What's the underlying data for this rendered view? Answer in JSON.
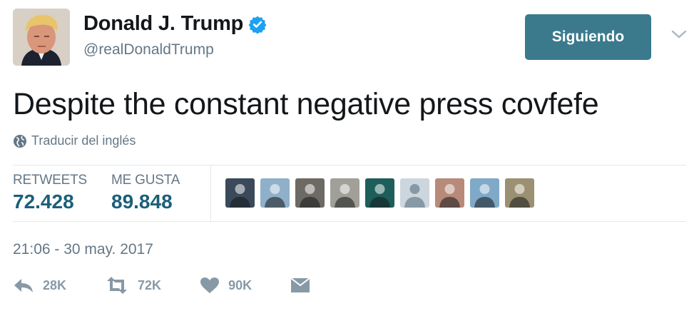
{
  "user": {
    "display_name": "Donald J. Trump",
    "handle": "@realDonaldTrump",
    "verified": true,
    "avatar_icon": "profile-photo"
  },
  "follow_button": {
    "label": "Siguiendo"
  },
  "tweet": {
    "text": "Despite the constant negative press covfefe",
    "translate_label": "Traducir del inglés"
  },
  "stats": {
    "retweets_label": "RETWEETS",
    "retweets_value": "72.428",
    "likes_label": "ME GUSTA",
    "likes_value": "89.848"
  },
  "likers": [
    {
      "icon": "group-selfie-avatar",
      "bg": "#3a4a5a"
    },
    {
      "icon": "cartoon-person-avatar",
      "bg": "#8fb0c8"
    },
    {
      "icon": "person-with-dog-avatar",
      "bg": "#6d6a63"
    },
    {
      "icon": "person-with-pet-avatar",
      "bg": "#a0a098"
    },
    {
      "icon": "white-cat-avatar",
      "bg": "#1e5e5a"
    },
    {
      "icon": "default-egg-avatar",
      "bg": "#ccd6dd"
    },
    {
      "icon": "person-sunset-avatar",
      "bg": "#b88a7a"
    },
    {
      "icon": "person-sky-avatar",
      "bg": "#7fa9c7"
    },
    {
      "icon": "person-outdoors-avatar",
      "bg": "#9b9071"
    }
  ],
  "timestamp": "21:06 - 30 may. 2017",
  "actions": {
    "reply_count": "28K",
    "retweet_count": "72K",
    "like_count": "90K"
  },
  "colors": {
    "follow_bg": "#3a7a8c",
    "stat_value": "#1b5f7a",
    "muted": "#657786",
    "verified": "#1da1f2"
  }
}
